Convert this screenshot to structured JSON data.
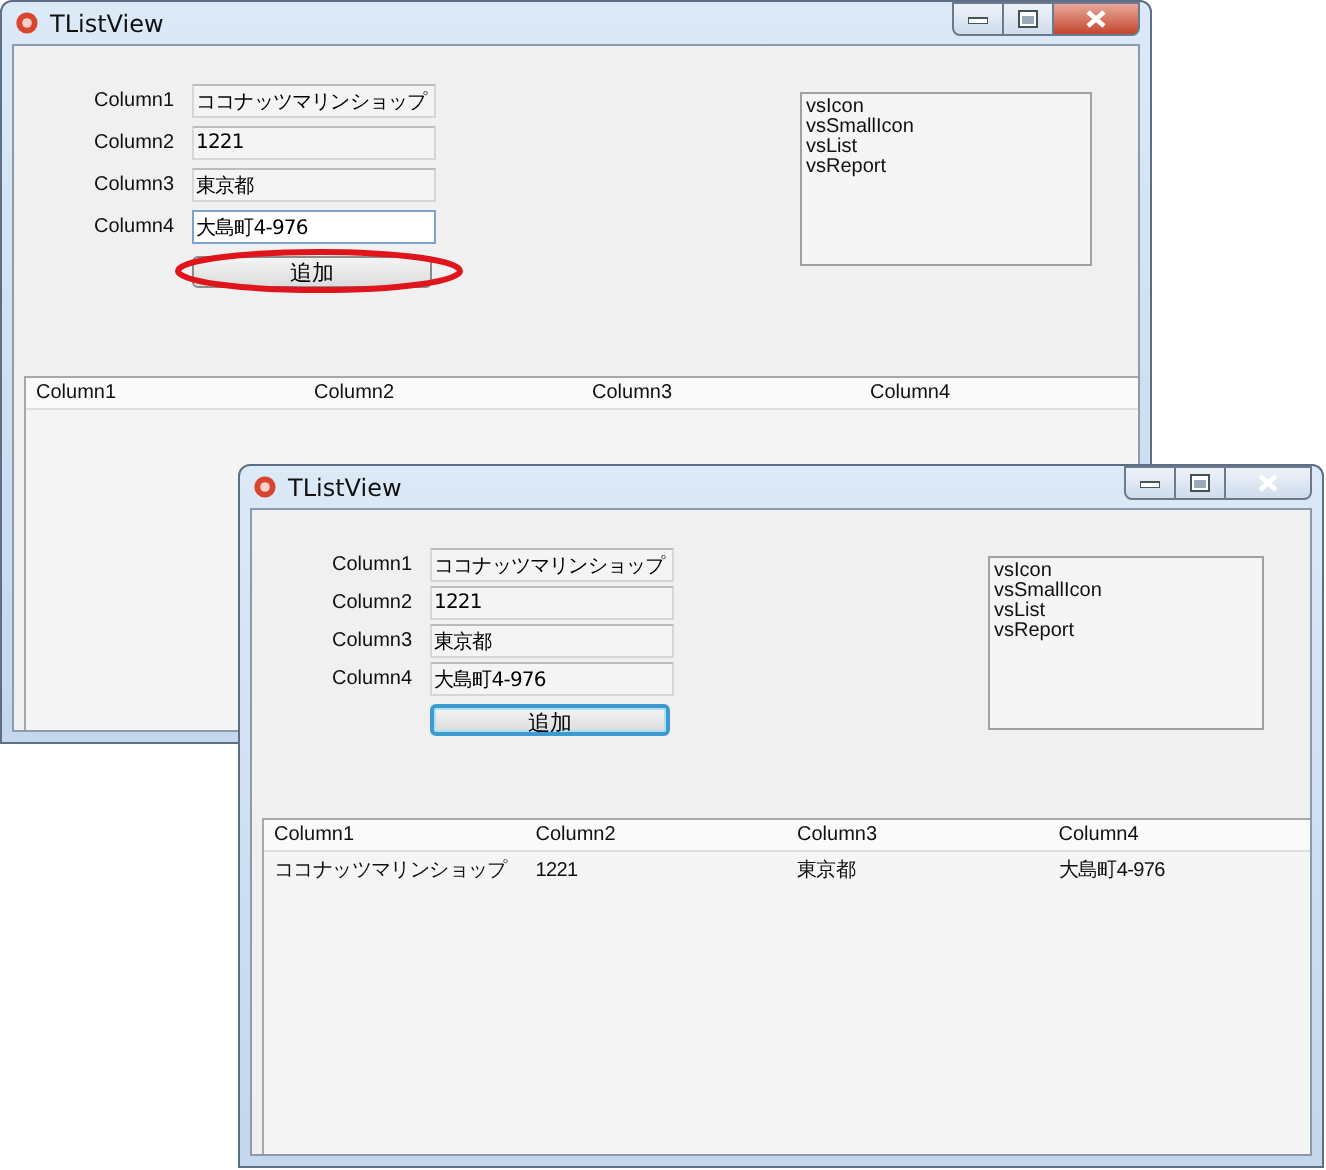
{
  "windows": [
    {
      "title": "TListView",
      "close_highlighted": true,
      "fields": [
        {
          "label": "Column1",
          "value": "ココナッツマリンショップ",
          "focused": false
        },
        {
          "label": "Column2",
          "value": "1221",
          "focused": false
        },
        {
          "label": "Column3",
          "value": "東京都",
          "focused": false
        },
        {
          "label": "Column4",
          "value": "大島町4-976",
          "focused": true
        }
      ],
      "button": {
        "label": "追加",
        "focused": false,
        "circled": true
      },
      "view_styles": [
        "vsIcon",
        "vsSmallIcon",
        "vsList",
        "vsReport"
      ],
      "list": {
        "columns": [
          "Column1",
          "Column2",
          "Column3",
          "Column4"
        ]
      }
    },
    {
      "title": "TListView",
      "close_highlighted": false,
      "fields": [
        {
          "label": "Column1",
          "value": "ココナッツマリンショップ",
          "focused": false
        },
        {
          "label": "Column2",
          "value": "1221",
          "focused": false
        },
        {
          "label": "Column3",
          "value": "東京都",
          "focused": false
        },
        {
          "label": "Column4",
          "value": "大島町4-976",
          "focused": false
        }
      ],
      "button": {
        "label": "追加",
        "focused": true
      },
      "view_styles": [
        "vsIcon",
        "vsSmallIcon",
        "vsList",
        "vsReport"
      ],
      "list": {
        "columns": [
          "Column1",
          "Column2",
          "Column3",
          "Column4"
        ],
        "rows": [
          [
            "ココナッツマリンショップ",
            "1221",
            "東京都",
            "大島町4-976"
          ]
        ]
      }
    }
  ]
}
